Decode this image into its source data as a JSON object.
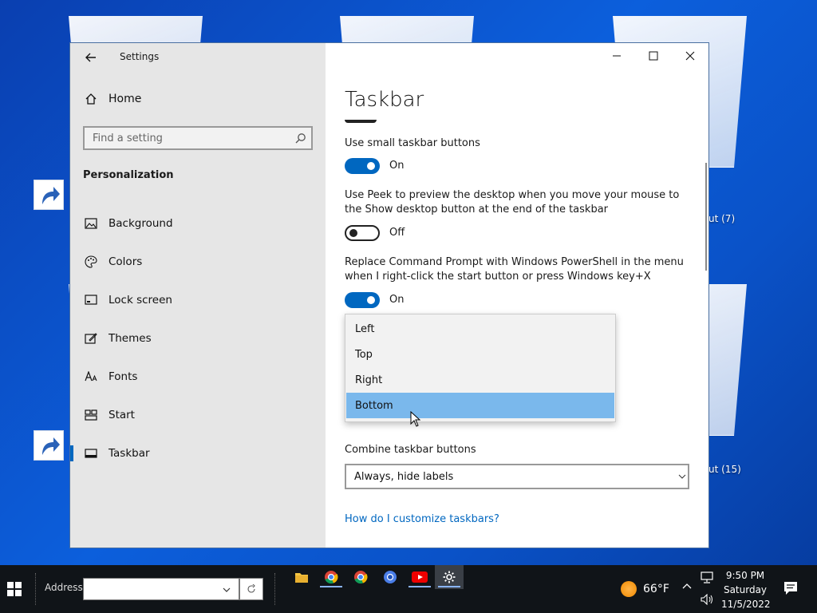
{
  "desktop": {
    "labels": [
      "ut (7)",
      "ut (15)"
    ]
  },
  "window": {
    "app_title": "Settings",
    "sidebar": {
      "home_label": "Home",
      "search_placeholder": "Find a setting",
      "section": "Personalization",
      "items": [
        {
          "label": "Background",
          "icon": "image-icon"
        },
        {
          "label": "Colors",
          "icon": "palette-icon"
        },
        {
          "label": "Lock screen",
          "icon": "lock-screen-icon"
        },
        {
          "label": "Themes",
          "icon": "themes-icon"
        },
        {
          "label": "Fonts",
          "icon": "fonts-icon"
        },
        {
          "label": "Start",
          "icon": "start-icon"
        },
        {
          "label": "Taskbar",
          "icon": "taskbar-icon",
          "active": true
        }
      ]
    },
    "content": {
      "title": "Taskbar",
      "settings": [
        {
          "label": "Use small taskbar buttons",
          "state": "On"
        },
        {
          "label": "Use Peek to preview the desktop when you move your mouse to the Show desktop button at the end of the taskbar",
          "state": "Off"
        },
        {
          "label": "Replace Command Prompt with Windows PowerShell in the menu when I right-click the start button or press Windows key+X",
          "state": "On"
        }
      ],
      "location_options": [
        "Left",
        "Top",
        "Right",
        "Bottom"
      ],
      "location_selected": "Bottom",
      "combine_label": "Combine taskbar buttons",
      "combine_value": "Always, hide labels",
      "help_link": "How do I customize taskbars?"
    }
  },
  "taskbar": {
    "address_label": "Address",
    "address_value": "",
    "apps": [
      "file-explorer-icon",
      "chrome-icon",
      "chrome-icon",
      "chrome-icon",
      "youtube-icon",
      "settings-gear-icon"
    ],
    "weather_temp": "66°F",
    "clock_time": "9:50 PM",
    "clock_day": "Saturday",
    "clock_date": "11/5/2022"
  },
  "colors": {
    "accent": "#0067c0",
    "selected_option": "#7ab8ec",
    "taskbar_bg": "#101418"
  }
}
